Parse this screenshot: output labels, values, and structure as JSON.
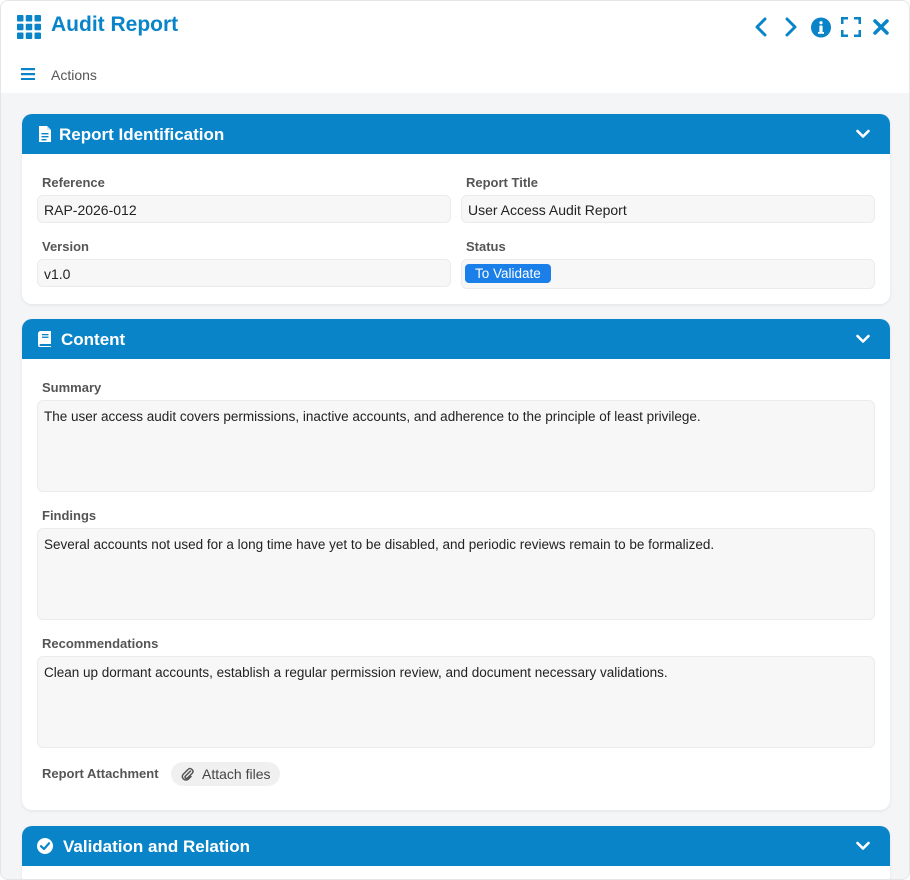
{
  "window": {
    "title": "Audit Report",
    "controls": [
      "prev-icon",
      "next-icon",
      "info-icon",
      "fullscreen-icon",
      "close-icon"
    ]
  },
  "toolbar": {
    "actions_label": "Actions"
  },
  "identification": {
    "title": "Report Identification",
    "reference_label": "Reference",
    "reference_value": "RAP-2026-012",
    "report_title_label": "Report Title",
    "report_title_value": "User Access Audit Report",
    "version_label": "Version",
    "version_value": "v1.0",
    "status_label": "Status",
    "status_value": "To Validate"
  },
  "content": {
    "title": "Content",
    "summary_label": "Summary",
    "summary_value": "The user access audit covers permissions, inactive accounts, and adherence to the principle of least privilege.",
    "findings_label": "Findings",
    "findings_value": "Several accounts not used for a long time have yet to be disabled, and periodic reviews remain to be formalized.",
    "recommendations_label": "Recommendations",
    "recommendations_value": "Clean up dormant accounts, establish a regular permission review, and document necessary validations.",
    "attachment_label": "Report Attachment",
    "attach_button": "Attach files"
  },
  "validation": {
    "title": "Validation and Relation"
  },
  "colors": {
    "accent": "#0a84c8",
    "badge": "#1a7fe8"
  }
}
